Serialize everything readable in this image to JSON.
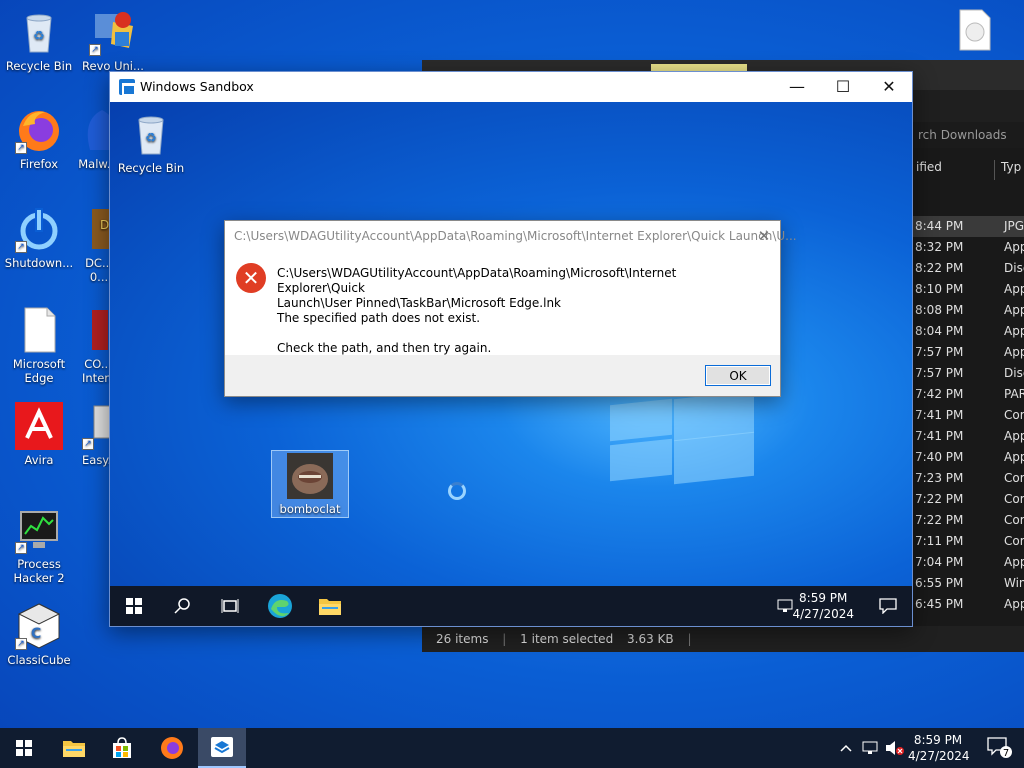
{
  "desktop": {
    "icons": [
      {
        "label": "Recycle Bin"
      },
      {
        "label": "Revo Uni..."
      },
      {
        "label": "Firefox"
      },
      {
        "label": "Malw..."
      },
      {
        "label": "Shutdown..."
      },
      {
        "label": "DC... 0..."
      },
      {
        "label": "Microsoft Edge"
      },
      {
        "label": "CO... Inter..."
      },
      {
        "label": "Avira"
      },
      {
        "label": "Easy..."
      },
      {
        "label": "Process Hacker 2"
      },
      {
        "label": "ClassiCube"
      }
    ]
  },
  "explorer": {
    "search_placeholder": "rch Downloads",
    "col_modified": "ified",
    "col_type": "Typ",
    "rows": [
      {
        "time": "8:44 PM",
        "type": "JPG",
        "selected": true
      },
      {
        "time": "8:32 PM",
        "type": "App"
      },
      {
        "time": "8:22 PM",
        "type": "Disc"
      },
      {
        "time": "8:10 PM",
        "type": "App"
      },
      {
        "time": "8:08 PM",
        "type": "App"
      },
      {
        "time": "8:04 PM",
        "type": "App"
      },
      {
        "time": "7:57 PM",
        "type": "App"
      },
      {
        "time": "7:57 PM",
        "type": "Disc"
      },
      {
        "time": "7:42 PM",
        "type": "PAR"
      },
      {
        "time": "7:41 PM",
        "type": "Cor"
      },
      {
        "time": "7:41 PM",
        "type": "App"
      },
      {
        "time": "7:40 PM",
        "type": "App"
      },
      {
        "time": "7:23 PM",
        "type": "Cor"
      },
      {
        "time": "7:22 PM",
        "type": "Cor"
      },
      {
        "time": "7:22 PM",
        "type": "Cor"
      },
      {
        "time": "7:11 PM",
        "type": "Cor"
      },
      {
        "time": "7:04 PM",
        "type": "App"
      },
      {
        "time": "6:55 PM",
        "type": "Win"
      },
      {
        "time": "6:45 PM",
        "type": "App"
      }
    ],
    "status": {
      "items": "26 items",
      "selected": "1 item selected",
      "size": "3.63 KB"
    }
  },
  "sandbox": {
    "title": "Windows Sandbox",
    "minimize": "—",
    "maximize": "☐",
    "close": "✕",
    "desktop_icons": {
      "recycle": "Recycle Bin",
      "file": "bomboclat"
    },
    "clock": {
      "time": "8:59 PM",
      "date": "4/27/2024"
    }
  },
  "dialog": {
    "title": "C:\\Users\\WDAGUtilityAccount\\AppData\\Roaming\\Microsoft\\Internet Explorer\\Quick Launch\\U...",
    "close": "✕",
    "line1": "C:\\Users\\WDAGUtilityAccount\\AppData\\Roaming\\Microsoft\\Internet Explorer\\Quick",
    "line2": "Launch\\User Pinned\\TaskBar\\Microsoft Edge.lnk",
    "line3": "The specified path does not exist.",
    "line4": "Check the path, and then try again.",
    "ok_label": "OK",
    "icon": "error-icon",
    "colors": {
      "error_red": "#e03d24",
      "button_border": "#0b6cd8"
    }
  },
  "host_taskbar": {
    "clock": {
      "time": "8:59 PM",
      "date": "4/27/2024"
    },
    "notif_count": "7"
  }
}
